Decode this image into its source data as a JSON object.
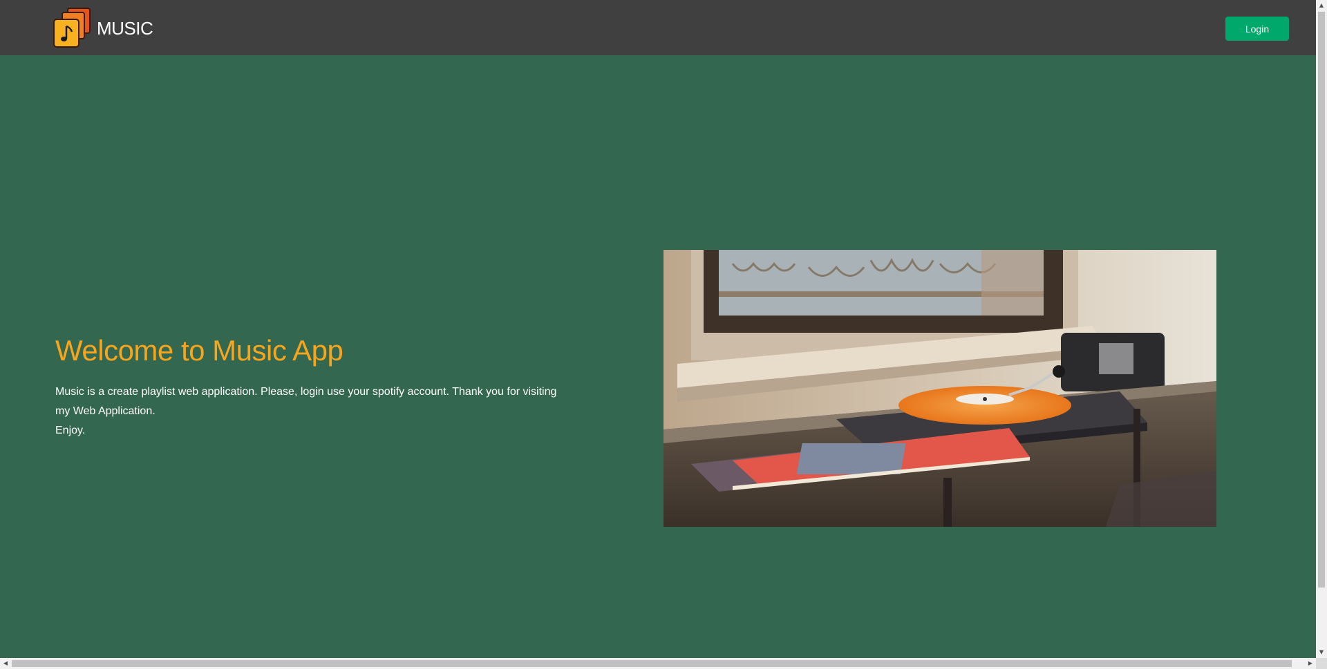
{
  "app": {
    "brand": "MUSIC",
    "login_label": "Login"
  },
  "hero": {
    "title": "Welcome to Music App",
    "description_line1": "Music is a create playlist web application. Please, login use your spotify account. Thank you for visiting my Web Application.",
    "description_line2": "Enjoy."
  },
  "colors": {
    "navbar": "#404040",
    "background": "#336750",
    "accent_title": "#f7a51c",
    "login_button": "#00a86b"
  },
  "icons": {
    "logo": "music-stack-logo-icon",
    "scroll_up": "chevron-up-icon",
    "scroll_down": "chevron-down-icon",
    "scroll_left": "chevron-left-icon",
    "scroll_right": "chevron-right-icon"
  }
}
